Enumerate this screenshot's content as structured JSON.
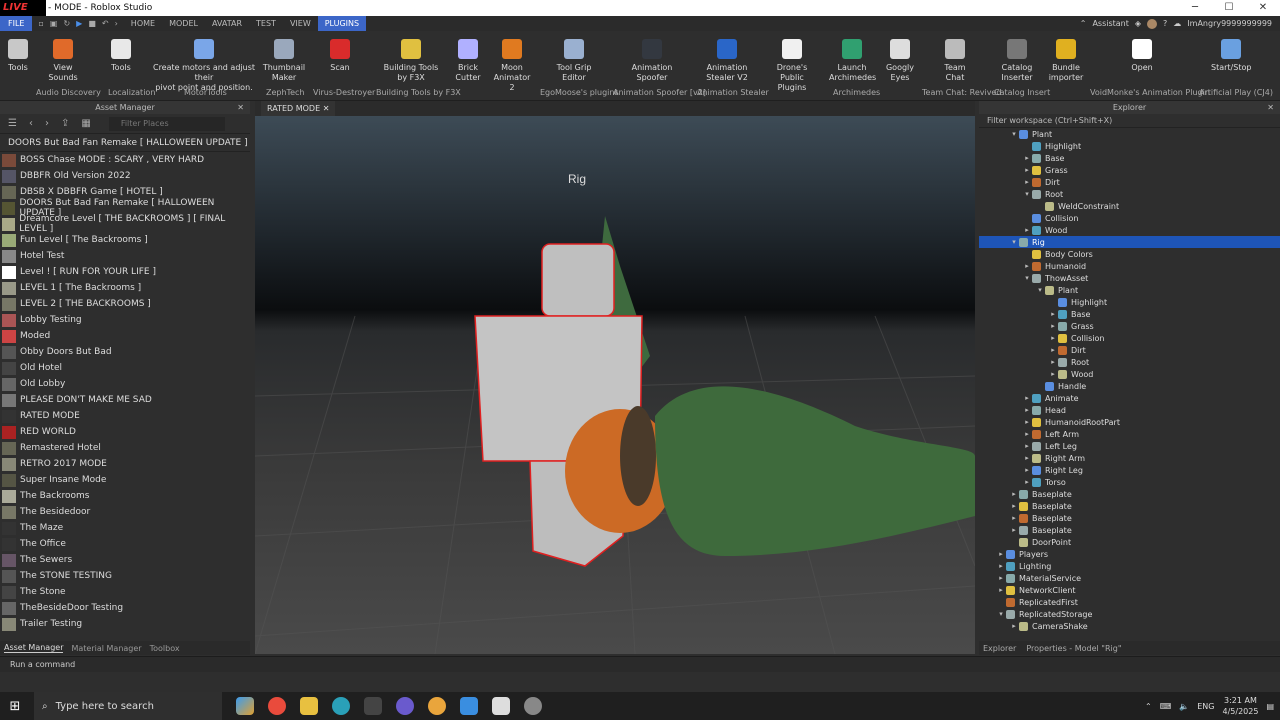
{
  "window": {
    "title": "RATED MODE - Roblox Studio",
    "title_visible": "- MODE - Roblox Studio",
    "logo_text": "LIVE"
  },
  "menu": {
    "file": "FILE",
    "tabs": [
      "HOME",
      "MODEL",
      "AVATAR",
      "TEST",
      "VIEW",
      "PLUGINS"
    ],
    "active_tab": "PLUGINS",
    "assistant": "Assistant",
    "user": "ImAngry9999999999"
  },
  "ribbon": {
    "buttons": [
      {
        "l1": "Tools",
        "l2": "",
        "color": "#c8c8c8"
      },
      {
        "l1": "View",
        "l2": "Sounds",
        "color": "#e06a2a"
      },
      {
        "l1": "Tools",
        "l2": "",
        "color": "#e8e8e8"
      },
      {
        "l1": "Create motors and adjust their",
        "l2": "pivot point and position.",
        "color": "#7aa6e8"
      },
      {
        "l1": "Thumbnail",
        "l2": "Maker",
        "color": "#9aa8bc"
      },
      {
        "l1": "Scan",
        "l2": "",
        "color": "#d92b2b"
      },
      {
        "l1": "Building Tools",
        "l2": "by F3X",
        "color": "#e0c040"
      },
      {
        "l1": "Brick",
        "l2": "Cutter",
        "color": "#b0b0ff"
      },
      {
        "l1": "Moon",
        "l2": "Animator 2",
        "color": "#e07a20"
      },
      {
        "l1": "Tool Grip",
        "l2": "Editor",
        "color": "#9ab0d0"
      },
      {
        "l1": "Animation",
        "l2": "Spoofer",
        "color": "#333840"
      },
      {
        "l1": "Animation",
        "l2": "Stealer V2",
        "color": "#2a66c8"
      },
      {
        "l1": "Drone's Public",
        "l2": "Plugins",
        "color": "#f0f0f0"
      },
      {
        "l1": "Launch",
        "l2": "Archimedes",
        "color": "#30a070"
      },
      {
        "l1": "Googly",
        "l2": "Eyes",
        "color": "#dddddd"
      },
      {
        "l1": "Team",
        "l2": "Chat",
        "color": "#bbbbbb"
      },
      {
        "l1": "Catalog",
        "l2": "Inserter",
        "color": "#777777"
      },
      {
        "l1": "Bundle",
        "l2": "importer",
        "color": "#e0b020"
      },
      {
        "l1": "Open",
        "l2": "",
        "color": "#ffffff"
      },
      {
        "l1": "Start/Stop",
        "l2": "",
        "color": "#6aa0e0"
      }
    ],
    "groups": [
      "Audio Discovery",
      "Localization",
      "MotorTools",
      "ZephTech",
      "Virus-Destroyer",
      "Building Tools by F3X",
      "EgoMoose's plugins",
      "Animation Spoofer [v2]",
      "Animation Stealer",
      "Archimedes",
      "Team Chat: Revived",
      "Catalog Insert",
      "VoidMonke's Animation Plugin",
      "Artificial Play (CJ4)"
    ]
  },
  "asset_manager": {
    "header": "Asset Manager",
    "filter_placeholder": "Filter Places",
    "game_title": "DOORS But Bad Fan Remake [ HALLOWEEN UPDATE ]",
    "places": [
      "BOSS Chase MODE : SCARY , VERY HARD",
      "DBBFR Old Version 2022",
      "DBSB X DBBFR Game [ HOTEL ]",
      "DOORS But Bad Fan Remake [ HALLOWEEN UPDATE ]",
      "Dreamcore Level [ THE BACKROOMS ] [ FINAL LEVEL ]",
      "Fun Level [ The Backrooms ]",
      "Hotel Test",
      "Level ! [ RUN FOR YOUR LIFE ]",
      "LEVEL 1 [ The Backrooms ]",
      "LEVEL 2 [ THE BACKROOMS ]",
      "Lobby Testing",
      "Moded",
      "Obby Doors But Bad",
      "Old Hotel",
      "Old Lobby",
      "PLEASE DON'T MAKE ME SAD",
      "RATED MODE",
      "RED WORLD",
      "Remastered Hotel",
      "RETRO 2017 MODE",
      "Super Insane Mode",
      "The Backrooms",
      "The Besidedoor",
      "The Maze",
      "The Office",
      "The Sewers",
      "The STONE TESTING",
      "The Stone",
      "TheBesideDoor Testing",
      "Trailer Testing"
    ],
    "bottom_tabs": [
      "Asset Manager",
      "Material Manager",
      "Toolbox"
    ]
  },
  "viewport": {
    "tab": "RATED MODE",
    "rig_label": "Rig"
  },
  "explorer": {
    "header": "Explorer",
    "filter": "Filter workspace (Ctrl+Shift+X)",
    "rows": [
      {
        "t": "Plant",
        "d": 2,
        "a": "▾"
      },
      {
        "t": "Highlight",
        "d": 3,
        "a": ""
      },
      {
        "t": "Base",
        "d": 3,
        "a": "▸"
      },
      {
        "t": "Grass",
        "d": 3,
        "a": "▸"
      },
      {
        "t": "Dirt",
        "d": 3,
        "a": "▸"
      },
      {
        "t": "Root",
        "d": 3,
        "a": "▾"
      },
      {
        "t": "WeldConstraint",
        "d": 4,
        "a": ""
      },
      {
        "t": "Collision",
        "d": 3,
        "a": ""
      },
      {
        "t": "Wood",
        "d": 3,
        "a": "▸"
      },
      {
        "t": "Rig",
        "d": 2,
        "a": "▾",
        "sel": true
      },
      {
        "t": "Body Colors",
        "d": 3,
        "a": ""
      },
      {
        "t": "Humanoid",
        "d": 3,
        "a": "▸"
      },
      {
        "t": "ThowAsset",
        "d": 3,
        "a": "▾"
      },
      {
        "t": "Plant",
        "d": 4,
        "a": "▾"
      },
      {
        "t": "Highlight",
        "d": 5,
        "a": ""
      },
      {
        "t": "Base",
        "d": 5,
        "a": "▸"
      },
      {
        "t": "Grass",
        "d": 5,
        "a": "▸"
      },
      {
        "t": "Collision",
        "d": 5,
        "a": "▸"
      },
      {
        "t": "Dirt",
        "d": 5,
        "a": "▸"
      },
      {
        "t": "Root",
        "d": 5,
        "a": "▸"
      },
      {
        "t": "Wood",
        "d": 5,
        "a": "▸"
      },
      {
        "t": "Handle",
        "d": 4,
        "a": ""
      },
      {
        "t": "Animate",
        "d": 3,
        "a": "▸"
      },
      {
        "t": "Head",
        "d": 3,
        "a": "▸"
      },
      {
        "t": "HumanoidRootPart",
        "d": 3,
        "a": "▸"
      },
      {
        "t": "Left Arm",
        "d": 3,
        "a": "▸"
      },
      {
        "t": "Left Leg",
        "d": 3,
        "a": "▸"
      },
      {
        "t": "Right Arm",
        "d": 3,
        "a": "▸"
      },
      {
        "t": "Right Leg",
        "d": 3,
        "a": "▸"
      },
      {
        "t": "Torso",
        "d": 3,
        "a": "▸"
      },
      {
        "t": "Baseplate",
        "d": 2,
        "a": "▸"
      },
      {
        "t": "Baseplate",
        "d": 2,
        "a": "▸"
      },
      {
        "t": "Baseplate",
        "d": 2,
        "a": "▸"
      },
      {
        "t": "Baseplate",
        "d": 2,
        "a": "▸"
      },
      {
        "t": "DoorPoint",
        "d": 2,
        "a": ""
      },
      {
        "t": "Players",
        "d": 1,
        "a": "▸"
      },
      {
        "t": "Lighting",
        "d": 1,
        "a": "▸"
      },
      {
        "t": "MaterialService",
        "d": 1,
        "a": "▸"
      },
      {
        "t": "NetworkClient",
        "d": 1,
        "a": "▸"
      },
      {
        "t": "ReplicatedFirst",
        "d": 1,
        "a": ""
      },
      {
        "t": "ReplicatedStorage",
        "d": 1,
        "a": "▾"
      },
      {
        "t": "CameraShake",
        "d": 2,
        "a": "▸"
      }
    ],
    "bottom_tabs": [
      "Explorer",
      "Properties - Model \"Rig\""
    ]
  },
  "command_bar": {
    "placeholder": "Run a command"
  },
  "taskbar": {
    "search": "Type here to search",
    "lang": "ENG",
    "time": "3:21 AM",
    "date": "4/5/2025"
  }
}
